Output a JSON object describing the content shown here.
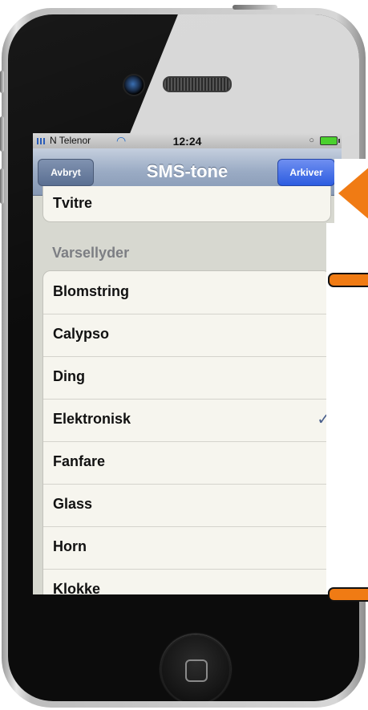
{
  "status_bar": {
    "carrier": "N Telenor",
    "time": "12:24"
  },
  "nav_bar": {
    "title": "SMS-tone",
    "left_button": "Avbryt",
    "right_button": "Arkiver"
  },
  "top_item": "Tvitre",
  "section_header": "Varsellyder",
  "tones": [
    {
      "label": "Blomstring",
      "checked": false
    },
    {
      "label": "Calypso",
      "checked": false
    },
    {
      "label": "Ding",
      "checked": false
    },
    {
      "label": "Elektronisk",
      "checked": true
    },
    {
      "label": "Fanfare",
      "checked": false
    },
    {
      "label": "Glass",
      "checked": false
    },
    {
      "label": "Horn",
      "checked": false
    },
    {
      "label": "Klokke",
      "checked": false
    }
  ],
  "checkmark": "✓",
  "colors": {
    "accent_button": "#2c5ce0",
    "nav_bar": "#9aabc4",
    "marker": "#f07b14"
  },
  "icons": [
    "signal-bars-icon",
    "wifi-icon",
    "alarm-icon",
    "battery-icon",
    "checkmark-icon",
    "home-button-icon"
  ]
}
